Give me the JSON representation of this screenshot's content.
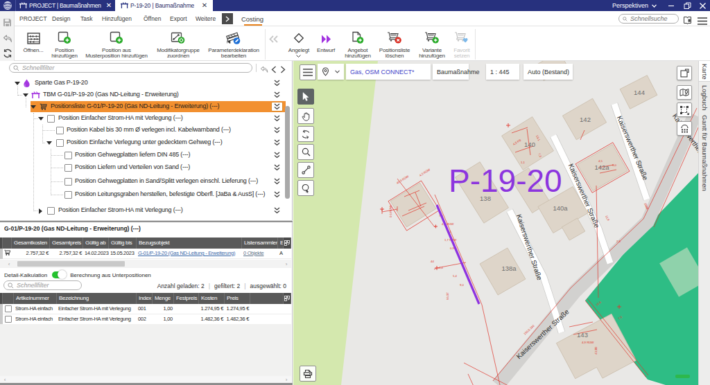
{
  "ui_colors": {
    "titlebar_navy": "#27317e",
    "accent_orange": "#e8831c",
    "selected_row_orange": "#f29030",
    "toggle_green": "#24c32e",
    "link_blue": "#3a68a8",
    "grid_header_grey": "#595959"
  },
  "titlebar": {
    "tabs": [
      {
        "label": "PROJECT | Baumaßnahmen"
      },
      {
        "label": "P-19-20 | Baumaßnahme"
      }
    ],
    "perspectives_label": "Perspektiven"
  },
  "menubar": {
    "items": [
      "PROJECT",
      "Design",
      "Task",
      "Hinzufügen",
      "Öffnen",
      "Export",
      "Weitere"
    ],
    "ribbon_tab": "Costing",
    "search_placeholder": "Schnellsuche"
  },
  "ribbon": {
    "buttons": [
      {
        "line1": "Öffnen...",
        "line2": ""
      },
      {
        "line1": "Position",
        "line2": "hinzufügen"
      },
      {
        "line1": "Position aus",
        "line2": "Musterposition hinzufügen"
      },
      {
        "line1": "Modifikatorgruppe",
        "line2": "zuordnen"
      },
      {
        "line1": "Parameterdeklaration",
        "line2": "bearbeiten"
      },
      {
        "line1": "Angelegt",
        "line2": ""
      },
      {
        "line1": "Entwurf",
        "line2": ""
      },
      {
        "line1": "Angebot",
        "line2": "hinzufügen"
      },
      {
        "line1": "Positionsliste",
        "line2": "löschen"
      },
      {
        "line1": "Variante",
        "line2": "hinzufügen"
      },
      {
        "line1": "Favorit",
        "line2": "setzen"
      }
    ]
  },
  "tree": {
    "filter_placeholder": "Schnellfilter",
    "rows": [
      {
        "label": "Sparte Gas P-19-20"
      },
      {
        "label": "TBM G-01/P-19-20 (Gas ND-Leitung - Erweiterung)"
      },
      {
        "label": "Positionsliste G-01/P-19-20 (Gas ND-Leitung - Erweiterung) (---)"
      },
      {
        "label": "Position Einfacher Strom-HA mit Verlegung (---)"
      },
      {
        "label": "Position Kabel bis 30 mm Ø verlegen incl. Kabelwarnband (---)"
      },
      {
        "label": "Position Einfache Verlegung unter gedecktem Gehweg (---)"
      },
      {
        "label": "Position Gehwegplatten liefern DIN 485 (---)"
      },
      {
        "label": "Position Liefern und Verteilen von Sand (---)"
      },
      {
        "label": "Position Gehwegplatten in Sand/Splitt verlegen einschl. Lieferung (---)"
      },
      {
        "label": "Position Leitungsgraben herstellen, befestigte Oberfl. [JaBa & AusS] (---)"
      },
      {
        "label": "Position Einfacher Strom-HA mit Verlegung (---)"
      }
    ]
  },
  "detail": {
    "heading": "G-01/P-19-20 (Gas ND-Leitung - Erweiterung) (---)",
    "table1": {
      "columns": [
        "Gesamtkosten",
        "Gesamtpreis",
        "Gültig ab",
        "Gültig bis",
        "Bezugsobjekt",
        "Listensammler",
        "E"
      ],
      "row": {
        "gesamtkosten": "2.757,32 €",
        "gesamtpreis": "2.757,32 €",
        "gueltig_ab": "14.02.2023",
        "gueltig_bis": "15.05.2023",
        "bezugsobjekt": "G-01/P-19-20 (Gas ND-Leitung - Erweiterung)",
        "listensammler": "0 Objekte",
        "e": "A"
      }
    },
    "toggle_label": "Detail-Kalkulation",
    "toggle_desc": "Berechnung aus Unterpositionen",
    "filter_placeholder": "Schnellfilter",
    "stats": {
      "loaded": "Anzahl geladen: 2",
      "filtered": "gefiltert: 2",
      "selected": "ausgewählt: 0",
      "sep": "|"
    },
    "table2": {
      "columns": [
        "Artikelnummer",
        "Bezeichnung",
        "Index",
        "Menge",
        "Festpreis",
        "Kosten",
        "Preis"
      ],
      "rows": [
        {
          "artikelnummer": "Strom-HA einfach",
          "bezeichnung": "Einfacher Strom-HA mit Verlegung",
          "index": "001",
          "menge": "1,00",
          "festpreis": "",
          "kosten": "1.274,95 €",
          "preis": "1.274,95 €"
        },
        {
          "artikelnummer": "Strom-HA einfach",
          "bezeichnung": "Einfacher Strom-HA mit Verlegung",
          "index": "002",
          "menge": "1,00",
          "festpreis": "",
          "kosten": "1.482,36 €",
          "preis": "1.482,36 €"
        }
      ]
    }
  },
  "map": {
    "toolbar": {
      "layer_text": "Gas, OSM CONNECT*",
      "context": "Baumaßnahme",
      "scale": "1 : 445",
      "mode": "Auto (Bestand)"
    },
    "plan_label": "P-19-20",
    "street_name": "Kaiserswerther Straße",
    "buildings": [
      "138",
      "140",
      "142",
      "144",
      "142a",
      "140a",
      "138a",
      "143"
    ],
    "dims": [
      "40,9 RÜW",
      "4,0 RÜW",
      "0,6 RÜW",
      "7,6",
      "4,7 RÜW",
      "3,1",
      "1,7 RÜW",
      "0,9",
      "4,4",
      "5,4",
      "9,0",
      "66,97",
      "4,5",
      "9,0",
      "11,9",
      "2,8",
      "10,6",
      "7,0",
      "44",
      "4,9 RÜW",
      "43,9B",
      "150,0,180",
      "2008",
      "4,5 PB",
      "13,1",
      "1,1",
      "7,3"
    ],
    "side_tabs": [
      "Karte",
      "Logbuch",
      "Gantt für Baumaßnahmen"
    ],
    "colors": {
      "greenspace": "#d4e8ae",
      "park_teal": "#2ebd85",
      "building": "#ded5c9",
      "cadastre_red": "#e0342a",
      "plan_purple": "#8c35de",
      "pipeline_purple": "#8e32e0"
    }
  }
}
